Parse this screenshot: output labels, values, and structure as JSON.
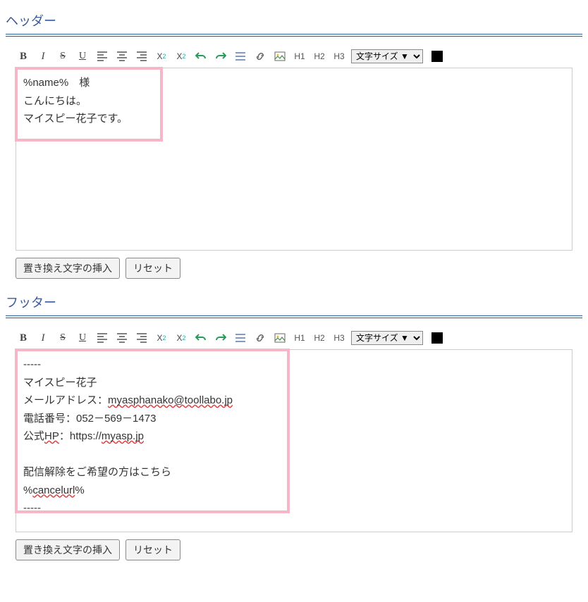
{
  "sections": {
    "header": {
      "title": "ヘッダー"
    },
    "footer": {
      "title": "フッター"
    }
  },
  "toolbar": {
    "bold": "B",
    "italic": "I",
    "strike": "S",
    "underline": "U",
    "sub_label": "X",
    "sub_sub": "2",
    "sup_label": "X",
    "sup_sup": "2",
    "h1": "H1",
    "h2": "H2",
    "h3": "H3",
    "font_size_label": "文字サイズ ▼"
  },
  "header_content": {
    "line1": "%name%　様",
    "line2": "こんにちは。",
    "line3": "マイスピー花子です。"
  },
  "footer_content": {
    "dash1": "-----",
    "line1": "マイスピー花子",
    "line2_pre": "メールアドレス：",
    "line2_mail": "myasphanako@toollabo.jp",
    "line3": "電話番号：052－569－1473",
    "line4_pre": "公式",
    "line4_hp": "HP",
    "line4_mid": "：https://",
    "line4_dom": "myasp.jp",
    "line5": "配信解除をご希望の方はこちら",
    "line6_pre": "%",
    "line6_mid": "cancelurl",
    "line6_post": "%",
    "dash2": "-----"
  },
  "buttons": {
    "insert_replace": "置き換え文字の挿入",
    "reset": "リセット"
  }
}
